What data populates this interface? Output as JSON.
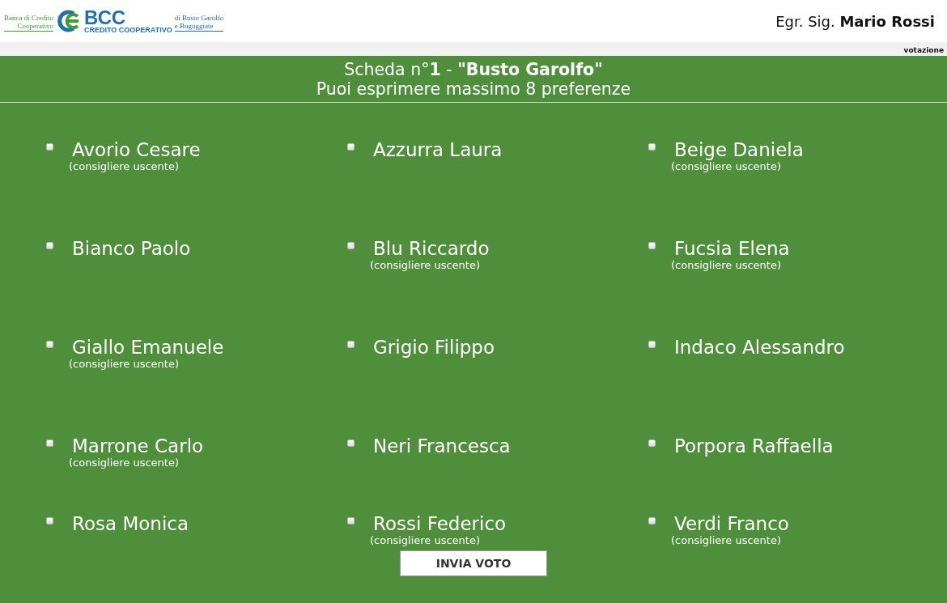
{
  "header": {
    "logo": {
      "left_lines": [
        "Banca di Credito",
        "Cooperativo"
      ],
      "wordmark": "BCC",
      "tagline": "CREDITO COOPERATIVO",
      "right_lines": [
        "di Busto Garolfo",
        "e Buguggiate"
      ]
    },
    "greeting": "Egr. Sig. **Mario Rossi**"
  },
  "nav_bar": {
    "label": "votazione"
  },
  "ballot": {
    "title": "Scheda n°**1** - **\"Busto Garolfo\"**",
    "subtitle": "Puoi esprimere massimo 8 preferenze",
    "candidates": [
      {
        "name": "Avorio Cesare",
        "note": "(consigliere uscente)",
        "checked": false
      },
      {
        "name": "Azzurra Laura",
        "checked": false
      },
      {
        "name": "Beige Daniela",
        "note": "(consigliere uscente)",
        "checked": false
      },
      {
        "name": "Bianco Paolo",
        "checked": false
      },
      {
        "name": "Blu Riccardo",
        "note": "(consigliere uscente)",
        "checked": false
      },
      {
        "name": "Fucsia Elena",
        "note": "(consigliere uscente)",
        "checked": false
      },
      {
        "name": "Giallo Emanuele",
        "note": "(consigliere uscente)",
        "checked": false
      },
      {
        "name": "Grigio Filippo",
        "checked": false
      },
      {
        "name": "Indaco Alessandro",
        "checked": false
      },
      {
        "name": "Marrone Carlo",
        "note": "(consigliere uscente)",
        "checked": false
      },
      {
        "name": "Neri Francesca",
        "checked": false
      },
      {
        "name": "Porpora Raffaella",
        "checked": false
      },
      {
        "name": "Rosa Monica",
        "checked": false
      },
      {
        "name": "Rossi Federico",
        "note": "(consigliere uscente)",
        "checked": false
      },
      {
        "name": "Verdi Franco",
        "note": "(consigliere uscente)",
        "checked": false
      }
    ],
    "submit_button": {
      "label": "INVIA VOTO"
    }
  }
}
